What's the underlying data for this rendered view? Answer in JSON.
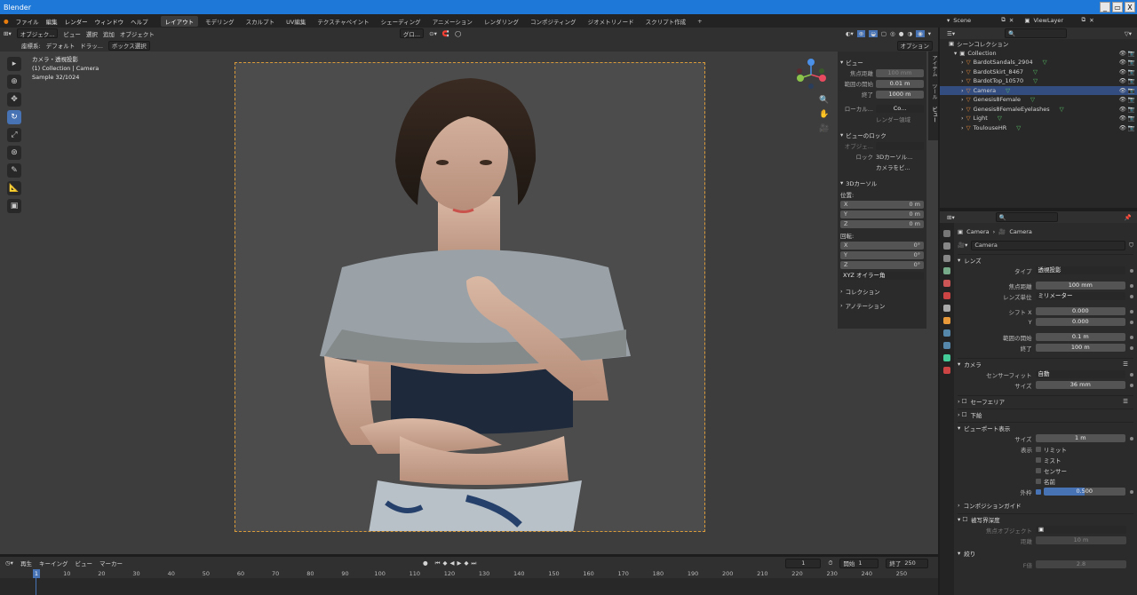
{
  "app": {
    "title": "Blender",
    "win_min": "_",
    "win_max": "▭",
    "win_close": "X"
  },
  "menu": [
    "ファイル",
    "編集",
    "レンダー",
    "ウィンドウ",
    "ヘルプ"
  ],
  "workspaces": [
    {
      "label": "レイアウト",
      "active": true
    },
    {
      "label": "モデリング"
    },
    {
      "label": "スカルプト"
    },
    {
      "label": "UV編集"
    },
    {
      "label": "テクスチャペイント"
    },
    {
      "label": "シェーディング"
    },
    {
      "label": "アニメーション"
    },
    {
      "label": "レンダリング"
    },
    {
      "label": "コンポジティング"
    },
    {
      "label": "ジオメトリノード"
    },
    {
      "label": "スクリプト作成"
    },
    {
      "label": "+"
    }
  ],
  "scene": {
    "scene_name": "Scene",
    "view_layer": "ViewLayer"
  },
  "viewport_header": {
    "mode": "オブジェク...",
    "items": [
      "ビュー",
      "選択",
      "追加",
      "オブジェクト"
    ],
    "orientation_label": "座標系:",
    "orientation": "デフォルト",
    "drag": "ドラッ...",
    "select_mode": "ボックス選択",
    "transform": "グロ...",
    "options": "オプション"
  },
  "viewport_info": {
    "line1": "カメラ・透視投影",
    "line2": "(1) Collection | Camera",
    "line3": "Sample 32/1024"
  },
  "npanel": {
    "view_title": "ビュー",
    "focal_label": "焦点距離",
    "focal": "100 mm",
    "clip_start_label": "範囲の開始",
    "clip_start": "0.01 m",
    "clip_end_label": "終了",
    "clip_end": "1000 m",
    "local_label": "ローカル...",
    "local_value": "Co...",
    "render_region": "レンダー領域",
    "lock_title": "ビューのロック",
    "lock_object_label": "オブジェ...",
    "lock_label": "ロック",
    "lock_cursor": "3Dカーソル...",
    "lock_camera": "カメラをビ...",
    "cursor_title": "3Dカーソル",
    "location_label": "位置:",
    "loc": [
      {
        "axis": "X",
        "value": "0 m"
      },
      {
        "axis": "Y",
        "value": "0 m"
      },
      {
        "axis": "Z",
        "value": "0 m"
      }
    ],
    "rotation_label": "回転:",
    "rot": [
      {
        "axis": "X",
        "value": "0°"
      },
      {
        "axis": "Y",
        "value": "0°"
      },
      {
        "axis": "Z",
        "value": "0°"
      }
    ],
    "rot_mode": "XYZ オイラー角",
    "collection": "コレクション",
    "annotation": "アノテーション",
    "tabs": [
      "アイテム",
      "ツール",
      "ビュー"
    ]
  },
  "outliner": {
    "root": "シーンコレクション",
    "collection": "Collection",
    "items": [
      {
        "name": "BardotSandals_2904",
        "selected": false
      },
      {
        "name": "BardotSkirt_8467",
        "selected": false
      },
      {
        "name": "BardotTop_10570",
        "selected": false
      },
      {
        "name": "Camera",
        "selected": true
      },
      {
        "name": "Genesis8Female",
        "selected": false
      },
      {
        "name": "Genesis8FemaleEyelashes",
        "selected": false
      },
      {
        "name": "Light",
        "selected": false
      },
      {
        "name": "ToulouseHR",
        "selected": false
      }
    ]
  },
  "properties": {
    "breadcrumb_a": "Camera",
    "breadcrumb_b": "Camera",
    "data_name": "Camera",
    "lens_title": "レンズ",
    "type_label": "タイプ",
    "type": "透視投影",
    "focal_label": "焦点距離",
    "focal": "100 mm",
    "lens_unit_label": "レンズ単位",
    "lens_unit": "ミリメーター",
    "shift_x_label": "シフト X",
    "shift_x": "0.000",
    "shift_y_label": "Y",
    "shift_y": "0.000",
    "clip_start_label": "範囲の開始",
    "clip_start": "0.1 m",
    "clip_end_label": "終了",
    "clip_end": "100 m",
    "camera_title": "カメラ",
    "sensor_fit_label": "センサーフィット",
    "sensor_fit": "自動",
    "size_label": "サイズ",
    "size": "36 mm",
    "safe_areas": "セーフエリア",
    "background": "下絵",
    "viewport_display": "ビューポート表示",
    "vd_size_label": "サイズ",
    "vd_size": "1 m",
    "show_label": "表示",
    "show_limits": "リミット",
    "show_mist": "ミスト",
    "show_sensor": "センサー",
    "show_name": "名前",
    "passepartout_label": "外枠",
    "passepartout": "0.500",
    "composition_guides": "コンポジションガイド",
    "dof": "被写界深度",
    "focus_object_label": "焦点オブジェクト",
    "distance_label": "距離",
    "distance": "10 m",
    "aperture": "絞り",
    "fstop_label": "F値",
    "fstop": "2.8"
  },
  "timeline": {
    "playback": "再生",
    "keying": "キーイング",
    "view": "ビュー",
    "marker": "マーカー",
    "current_frame": "1",
    "start_label": "開始",
    "start": "1",
    "end_label": "終了",
    "end": "250",
    "ruler": [
      "1",
      "10",
      "20",
      "30",
      "40",
      "50",
      "60",
      "70",
      "80",
      "90",
      "100",
      "110",
      "120",
      "130",
      "140",
      "150",
      "160",
      "170",
      "180",
      "190",
      "200",
      "210",
      "220",
      "230",
      "240",
      "250"
    ]
  },
  "colors": {
    "accent": "#4772b3",
    "titlebar": "#1e78d7",
    "camera_frame": "#d99a3a",
    "selected_row": "#334d80"
  }
}
